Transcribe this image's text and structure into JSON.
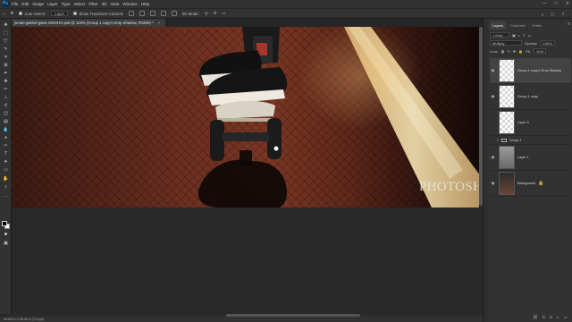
{
  "app": {
    "logo": "Ps",
    "menus": [
      "File",
      "Edit",
      "Image",
      "Layer",
      "Type",
      "Select",
      "Filter",
      "3D",
      "View",
      "Window",
      "Help"
    ],
    "window_controls": [
      "—",
      "□",
      "✕"
    ]
  },
  "options": {
    "auto_select_label": "Auto-Select:",
    "auto_select_value": "Layer",
    "show_transform_label": "Show Transform Controls",
    "mode_3d_label": "3D Mode:"
  },
  "document": {
    "tab_title": "jonatn-gabriel-gatto-44SGHG.psd @ 100% (Group 1 copy's Drop Shadow, RGB/8) *",
    "close": "×"
  },
  "watermark": "PHOTOSHOPIX",
  "status": "25.83 in x 36.03 in (72 ppi)",
  "layers_panel": {
    "tabs": [
      "Layers",
      "Channels",
      "Paths"
    ],
    "active_tab": "Layers",
    "blend_mode": "Multiply",
    "opacity_label": "Opacity:",
    "opacity_value": "100%",
    "lock_label": "Lock:",
    "fill_label": "Fill:",
    "fill_value": "90%",
    "layers": [
      {
        "name": "Group 1 copy's Drop Shadow",
        "selected": true,
        "visible": true,
        "thumb": "transparent"
      },
      {
        "name": "Group 1 copy",
        "selected": false,
        "visible": true,
        "thumb": "transparent"
      },
      {
        "name": "Layer 3",
        "selected": false,
        "visible": false,
        "thumb": "transparent"
      },
      {
        "name": "Group 1",
        "selected": false,
        "visible": false,
        "thumb": "group"
      },
      {
        "name": "Layer 1",
        "selected": false,
        "visible": true,
        "thumb": "photo"
      },
      {
        "name": "Background",
        "selected": false,
        "visible": true,
        "thumb": "dark"
      }
    ],
    "bottom_icons": [
      "link-icon",
      "fx-icon",
      "mask-icon",
      "adjustment-icon",
      "folder-icon",
      "new-layer-icon",
      "trash-icon"
    ]
  },
  "colors": {
    "menubar": "#323232",
    "canvas_bg": "#282828",
    "accent": "#31a8ff"
  }
}
